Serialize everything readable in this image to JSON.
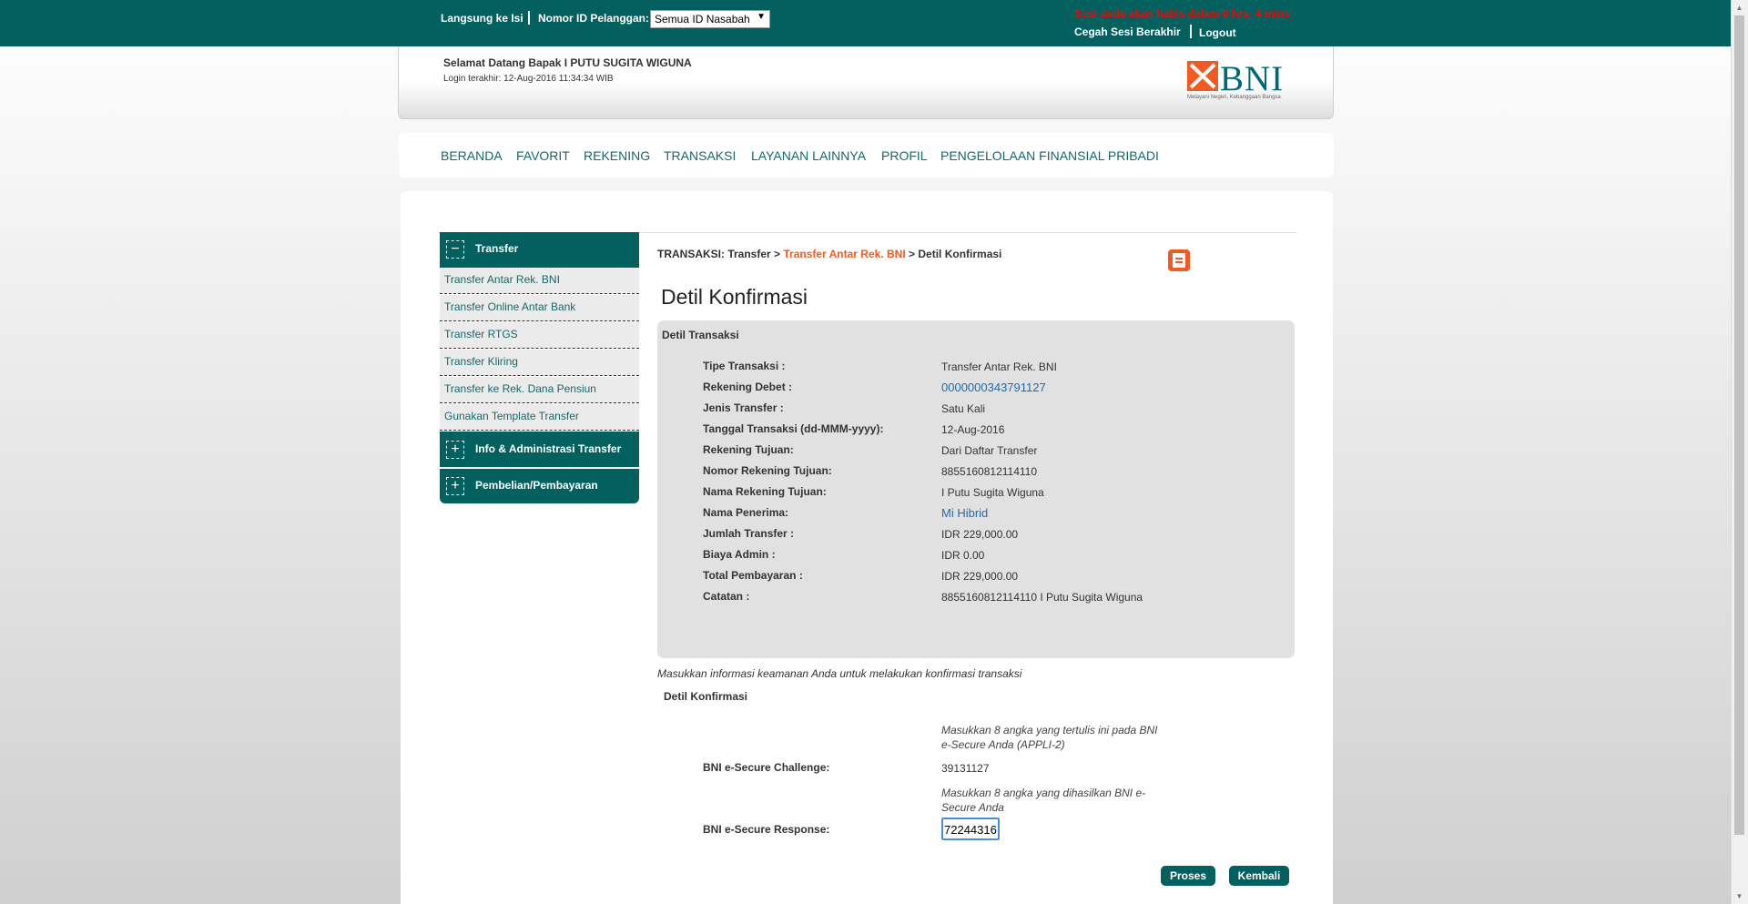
{
  "topbar": {
    "quick_fill_label": "Langsung ke Isi",
    "customer_id_label": "Nomor ID Pelanggan:",
    "customer_id_selected": "Semua ID Nasabah",
    "session_warning": "Sesi anda akan habis dalam 0 hrs: 4 mins",
    "prevent_session_end": "Cegah Sesi Berakhir",
    "logout": "Logout"
  },
  "header": {
    "welcome": "Selamat Datang Bapak  I PUTU  SUGITA  WIGUNA",
    "last_login": "Login terakhir:  12-Aug-2016 11:34:34  WIB",
    "logo_text": "BNI",
    "logo_tagline": "Melayani Negeri, Kebanggaan Bangsa",
    "brand_colors": {
      "teal": "#02605f",
      "orange": "#f15a22"
    }
  },
  "nav": [
    "BERANDA",
    "FAVORIT",
    "REKENING",
    "TRANSAKSI",
    "LAYANAN LAINNYA",
    "PROFIL",
    "PENGELOLAAN FINANSIAL PRIBADI"
  ],
  "sidebar": {
    "transfer": {
      "label": "Transfer",
      "icon": "minus-box-icon"
    },
    "items": [
      "Transfer Antar Rek. BNI",
      "Transfer Online Antar Bank",
      "Transfer RTGS",
      "Transfer Kliring",
      "Transfer ke Rek. Dana Pensiun",
      "Gunakan Template Transfer"
    ],
    "info_admin": {
      "label": "Info & Administrasi Transfer",
      "icon": "plus-box-icon"
    },
    "purchase": {
      "label": "Pembelian/Pembayaran",
      "icon": "plus-box-icon"
    }
  },
  "breadcrumb": {
    "first": "TRANSAKSI: Transfer",
    "sep": ">",
    "middle": "Transfer Antar Rek. BNI",
    "last": "Detil Konfirmasi"
  },
  "page_title": "Detil Konfirmasi",
  "detail": {
    "title": "Detil Transaksi",
    "rows": [
      {
        "label": "Tipe Transaksi :",
        "value": "Transfer Antar Rek. BNI"
      },
      {
        "label": "Rekening Debet :",
        "value": "0000000343791127"
      },
      {
        "label": "Jenis Transfer :",
        "value": "Satu Kali"
      },
      {
        "label": "Tanggal Transaksi (dd-MMM-yyyy):",
        "value": "12-Aug-2016"
      },
      {
        "label": "Rekening Tujuan:",
        "value": "Dari Daftar Transfer"
      },
      {
        "label": "Nomor Rekening Tujuan:",
        "value": "8855160812114110"
      },
      {
        "label": "Nama Rekening Tujuan:",
        "value": "I Putu Sugita Wiguna"
      },
      {
        "label": "Nama Penerima:",
        "value": "Mi Hibrid"
      },
      {
        "label": "Jumlah Transfer :",
        "value": "IDR 229,000.00"
      },
      {
        "label": "Biaya Admin :",
        "value": "IDR 0.00"
      },
      {
        "label": "Total Pembayaran :",
        "value": "IDR 229,000.00"
      },
      {
        "label": "Catatan :",
        "value": "8855160812114110 I Putu Sugita Wiguna"
      }
    ]
  },
  "security": {
    "note": "Masukkan informasi keamanan Anda untuk melakukan konfirmasi transaksi",
    "title": "Detil Konfirmasi",
    "challenge_hint": "Masukkan 8 angka yang tertulis ini pada BNI e-Secure Anda (APPLI-2)",
    "challenge_label": "BNI e-Secure Challenge:",
    "challenge_value": "39131127",
    "response_hint": "Masukkan 8 angka yang dihasilkan BNI e-Secure Anda",
    "response_label": "BNI e-Secure Response:",
    "response_value": "72244316"
  },
  "buttons": {
    "proses": "Proses",
    "kembali": "Kembali"
  }
}
